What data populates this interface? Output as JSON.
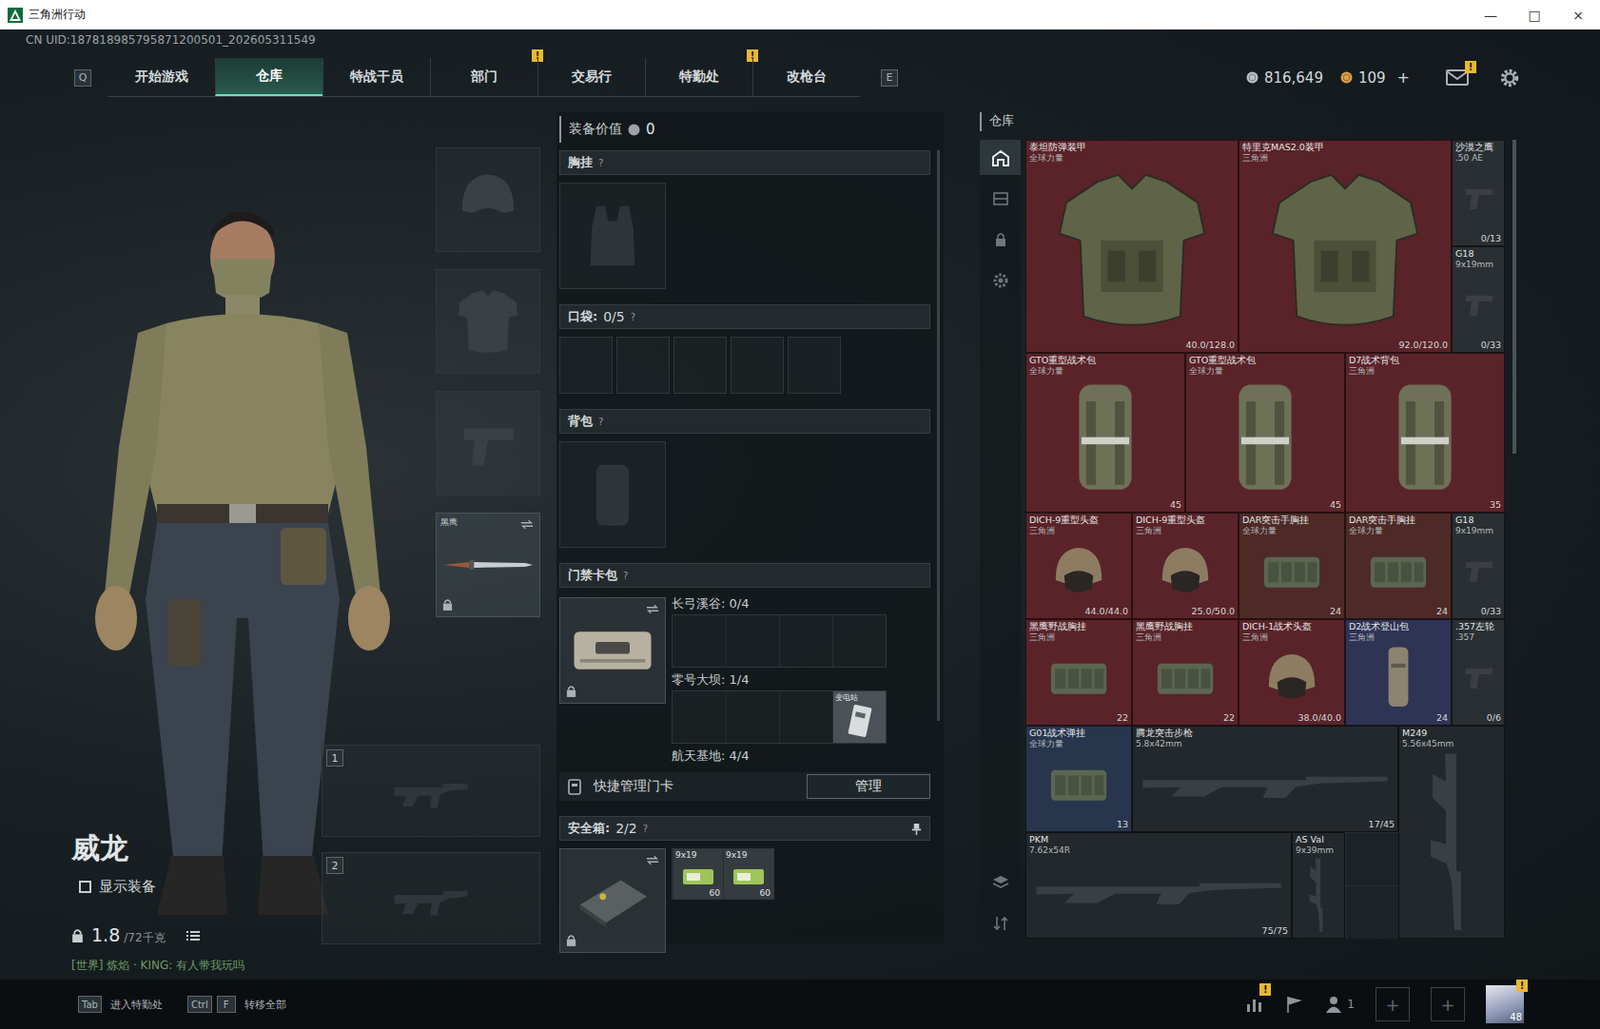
{
  "window": {
    "title": "三角洲行动",
    "controls": [
      "—",
      "□",
      "×"
    ]
  },
  "uid": "CN UID:187818985795871200501_202605311549",
  "nav": {
    "prev_key": "Q",
    "next_key": "E",
    "tabs": [
      {
        "label": "开始游戏",
        "selected": false,
        "badge": null
      },
      {
        "label": "仓库",
        "selected": true,
        "badge": null
      },
      {
        "label": "特战干员",
        "selected": false,
        "badge": null
      },
      {
        "label": "部门",
        "selected": false,
        "badge": "!"
      },
      {
        "label": "交易行",
        "selected": false,
        "badge": null
      },
      {
        "label": "特勤处",
        "selected": false,
        "badge": "!"
      },
      {
        "label": "改枪台",
        "selected": false,
        "badge": null
      }
    ]
  },
  "currencies": [
    {
      "amount": "816,649",
      "color": "#b9c2c8",
      "add": null
    },
    {
      "amount": "109",
      "color": "#d9a24a",
      "add": "+"
    }
  ],
  "mail_badge": "!",
  "character": {
    "name": "威龙",
    "show_equipment": {
      "label": "显示装备",
      "checked": false
    },
    "weight": "1.8",
    "weight_max": "/72千克",
    "chat": "[世界] 炼焰 · KING: 有人带我玩吗"
  },
  "equip_slots": [
    {
      "kind": "helmet",
      "filled": false,
      "label": null,
      "locked": false
    },
    {
      "kind": "armor",
      "filled": false,
      "label": null,
      "locked": false
    },
    {
      "kind": "pistol",
      "filled": false,
      "label": null,
      "locked": false
    },
    {
      "kind": "melee",
      "filled": true,
      "label": "黑鹰",
      "locked": true
    }
  ],
  "weapon_slots": [
    {
      "number": "1",
      "filled": false
    },
    {
      "number": "2",
      "filled": false
    }
  ],
  "loadout": {
    "value_label": "装备价值",
    "value": "0",
    "chest": {
      "label": "胸挂",
      "help": "?"
    },
    "pockets": {
      "label": "口袋:",
      "count": "0/5",
      "help": "?",
      "slots": [
        {
          "filled": false
        },
        {
          "filled": false
        },
        {
          "filled": false
        },
        {
          "filled": false
        },
        {
          "filled": false
        }
      ]
    },
    "backpack": {
      "label": "背包",
      "help": "?"
    },
    "keycards": {
      "label": "门禁卡包",
      "help": "?",
      "locked": true,
      "maps": [
        {
          "name": "长弓溪谷: 0/4",
          "cards": [
            {
              "filled": false,
              "label": null
            },
            {
              "filled": false,
              "label": null
            },
            {
              "filled": false,
              "label": null
            },
            {
              "filled": false,
              "label": null
            }
          ]
        },
        {
          "name": "零号大坝: 1/4",
          "cards": [
            {
              "filled": false,
              "label": null
            },
            {
              "filled": false,
              "label": null
            },
            {
              "filled": false,
              "label": null
            },
            {
              "filled": true,
              "label": "变电站"
            }
          ]
        },
        {
          "name": "航天基地: 4/4",
          "cards": []
        }
      ]
    },
    "quick_manage": {
      "label": "快捷管理门卡",
      "button": "管理"
    },
    "safebox": {
      "label": "安全箱:",
      "count": "2/2",
      "help": "?",
      "locked": true,
      "items": [
        {
          "caliber": "9x19",
          "qty": "60"
        },
        {
          "caliber": "9x19",
          "qty": "60"
        }
      ]
    }
  },
  "stash": {
    "label": "仓库",
    "side_tools": [
      {
        "selected": true
      },
      {
        "selected": false
      },
      {
        "selected": false
      },
      {
        "selected": false
      }
    ],
    "bottom_tools": [
      {
        "selected": false
      },
      {
        "selected": false
      }
    ],
    "items": [
      {
        "name": "泰坦防弹装甲",
        "faction": "全球力量",
        "reading": "40.0/128.0",
        "kind": "armor",
        "color": "#5a2329"
      },
      {
        "name": "特里克MAS2.0装甲",
        "faction": "三角洲",
        "reading": "92.0/120.0",
        "kind": "armor",
        "color": "#5a2329"
      },
      {
        "name": "沙漠之鹰",
        "faction": ".50 AE",
        "reading": "0/13",
        "kind": "pistol",
        "color": "#2a2f33"
      },
      {
        "name": "G18",
        "faction": "9x19mm",
        "reading": "0/33",
        "kind": "pistol",
        "color": "#2a2f33"
      },
      {
        "name": "GTO重型战术包",
        "faction": "全球力量",
        "reading": "45",
        "kind": "backpack",
        "color": "#5a2329"
      },
      {
        "name": "GTO重型战术包",
        "faction": "全球力量",
        "reading": "45",
        "kind": "backpack",
        "color": "#5a2329"
      },
      {
        "name": "D7战术背包",
        "faction": "三角洲",
        "reading": "35",
        "kind": "backpack",
        "color": "#5a2329"
      },
      {
        "name": "DICH-9重型头盔",
        "faction": "三角洲",
        "reading": "44.0/44.0",
        "kind": "helmet",
        "color": "#5a2329"
      },
      {
        "name": "DICH-9重型头盔",
        "faction": "三角洲",
        "reading": "25.0/50.0",
        "kind": "helmet",
        "color": "#5a2329"
      },
      {
        "name": "DAR突击手胸挂",
        "faction": "全球力量",
        "reading": "24",
        "kind": "rig",
        "color": "#4e2a26"
      },
      {
        "name": "DAR突击手胸挂",
        "faction": "全球力量",
        "reading": "24",
        "kind": "rig",
        "color": "#4e2a26"
      },
      {
        "name": "G18",
        "faction": "9x19mm",
        "reading": "0/33",
        "kind": "pistol",
        "color": "#2a2f33"
      },
      {
        "name": "黑鹰野战胸挂",
        "faction": "三角洲",
        "reading": "22",
        "kind": "rig",
        "color": "#5a2329"
      },
      {
        "name": "黑鹰野战胸挂",
        "faction": "三角洲",
        "reading": "22",
        "kind": "rig",
        "color": "#5a2329"
      },
      {
        "name": "DICH-1战术头盔",
        "faction": "三角洲",
        "reading": "38.0/40.0",
        "kind": "helmet",
        "color": "#5a2329"
      },
      {
        "name": "D2战术登山包",
        "faction": "三角洲",
        "reading": "24",
        "kind": "daypack",
        "color": "#2f3354"
      },
      {
        "name": ".357左轮",
        "faction": ".357",
        "reading": "0/6",
        "kind": "pistol",
        "color": "#2a2f33"
      },
      {
        "name": "G01战术弹挂",
        "faction": "全球力量",
        "reading": "13",
        "kind": "rig",
        "color": "#27364d"
      },
      {
        "name": "腾龙突击步枪",
        "faction": "5.8x42mm",
        "reading": "17/45",
        "kind": "rifle",
        "color": "#23282c"
      },
      {
        "name": "M249",
        "faction": "5.56x45mm",
        "reading": null,
        "kind": "upright",
        "color": "#23282c"
      },
      {
        "name": "PKM",
        "faction": "7.62x54R",
        "reading": "75/75",
        "kind": "rifle",
        "color": "#23282c"
      },
      {
        "name": "AS Val",
        "faction": "9x39mm",
        "reading": null,
        "kind": "carbine",
        "color": "#23282c"
      }
    ]
  },
  "bottom": {
    "shortcuts": [
      {
        "keys": [
          "Tab"
        ],
        "label": "进入特勤处"
      },
      {
        "keys": [
          "Ctrl",
          "F"
        ],
        "label": "转移全部"
      }
    ],
    "stats_badge": "!",
    "squad_count": "1",
    "invite_slots": [
      "+",
      "+"
    ],
    "avatar_badge": "!",
    "avatar_level": "48"
  }
}
